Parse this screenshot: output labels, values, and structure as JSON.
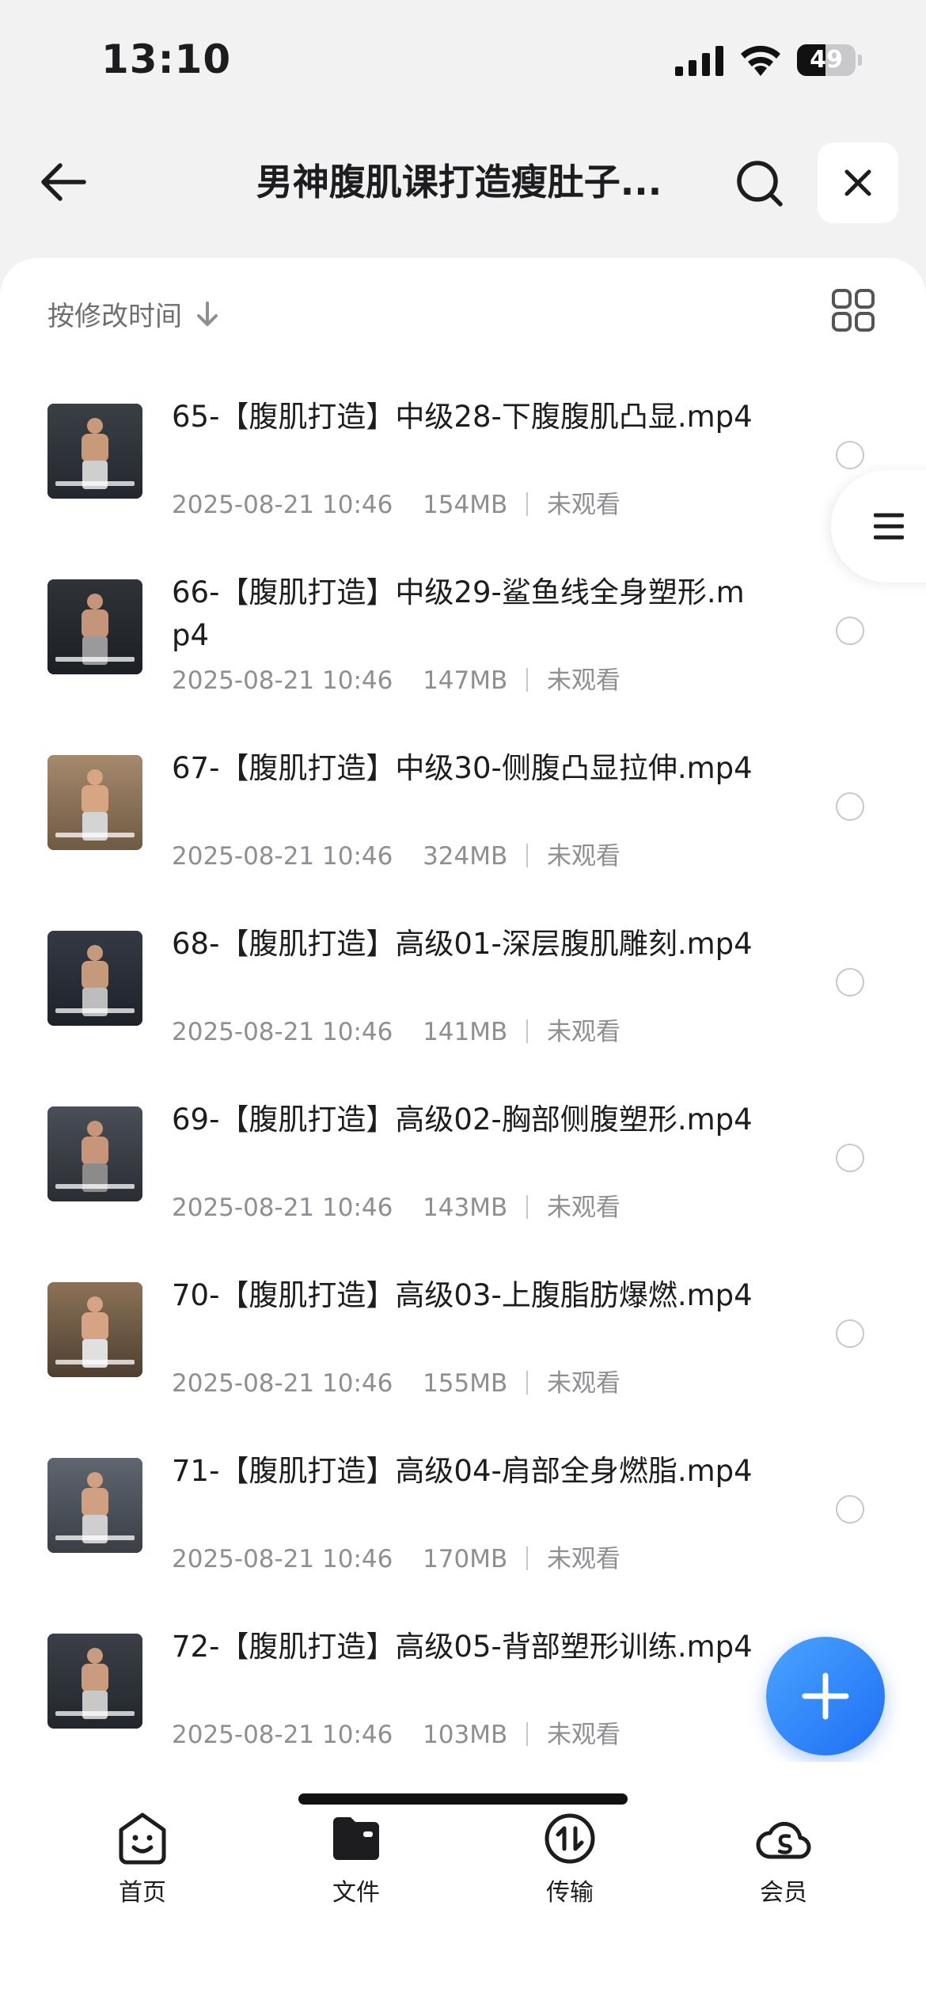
{
  "status_bar": {
    "time": "13:10",
    "battery_percent": "49",
    "battery_level": 0.49
  },
  "header": {
    "title": "男神腹肌课打造瘦肚子..."
  },
  "sort": {
    "label": "按修改时间"
  },
  "files": [
    {
      "name": "65-【腹肌打造】中级28-下腹腹肌凸显.mp4",
      "date": "2025-08-21 10:46",
      "size": "154MB",
      "status": "未观看"
    },
    {
      "name": "66-【腹肌打造】中级29-鲨鱼线全身塑形.mp4",
      "date": "2025-08-21 10:46",
      "size": "147MB",
      "status": "未观看"
    },
    {
      "name": "67-【腹肌打造】中级30-侧腹凸显拉伸.mp4",
      "date": "2025-08-21 10:46",
      "size": "324MB",
      "status": "未观看"
    },
    {
      "name": "68-【腹肌打造】高级01-深层腹肌雕刻.mp4",
      "date": "2025-08-21 10:46",
      "size": "141MB",
      "status": "未观看"
    },
    {
      "name": "69-【腹肌打造】高级02-胸部侧腹塑形.mp4",
      "date": "2025-08-21 10:46",
      "size": "143MB",
      "status": "未观看"
    },
    {
      "name": "70-【腹肌打造】高级03-上腹脂肪爆燃.mp4",
      "date": "2025-08-21 10:46",
      "size": "155MB",
      "status": "未观看"
    },
    {
      "name": "71-【腹肌打造】高级04-肩部全身燃脂.mp4",
      "date": "2025-08-21 10:46",
      "size": "170MB",
      "status": "未观看"
    },
    {
      "name": "72-【腹肌打造】高级05-背部塑形训练.mp4",
      "date": "2025-08-21 10:46",
      "size": "103MB",
      "status": "未观看"
    }
  ],
  "nav": [
    {
      "label": "首页",
      "icon": "home-smile-icon"
    },
    {
      "label": "文件",
      "icon": "folder-icon"
    },
    {
      "label": "传输",
      "icon": "transfer-icon"
    },
    {
      "label": "会员",
      "icon": "vip-cloud-icon"
    }
  ],
  "colors": {
    "accent": "#1f6ef5",
    "text": "#1d1d1f",
    "meta": "#8e8e93",
    "background": "#f2f2f3"
  }
}
